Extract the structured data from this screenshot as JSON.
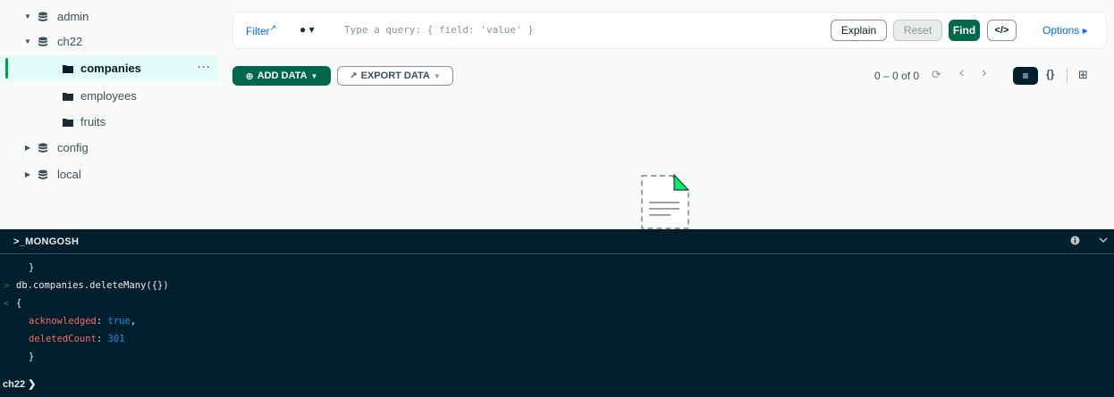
{
  "sidebar": {
    "databases": [
      {
        "name": "admin",
        "expanded": true
      },
      {
        "name": "ch22",
        "expanded": true,
        "collections": [
          "companies",
          "employees",
          "fruits"
        ]
      },
      {
        "name": "config",
        "expanded": false
      },
      {
        "name": "local",
        "expanded": false
      }
    ],
    "active_collection": "companies",
    "more_label": "···",
    "icons": {
      "database": "database-icon",
      "collection": "folder-icon"
    }
  },
  "query_bar": {
    "filter_label": "Filter",
    "filter_ext_icon": "↗",
    "history_icon": "● ▾",
    "placeholder": "Type a query: { field: 'value' }",
    "explain_label": "Explain",
    "reset_label": "Reset",
    "find_label": "Find",
    "code_label": "</>",
    "options_label": "Options ▸"
  },
  "toolbar": {
    "add_data_label": "ADD DATA",
    "export_data_label": "EXPORT DATA",
    "pagination": "0 – 0 of 0",
    "refresh_icon": "⟳",
    "prev_icon": "‹",
    "next_icon": "›",
    "view_list_icon": "≡",
    "view_json_icon": "{}",
    "view_table_icon": "⊞"
  },
  "shell": {
    "title": ">_MONGOSH",
    "info_icon": "🛈",
    "collapse_icon": "⌄",
    "lines": [
      {
        "prefix": "",
        "text": "}"
      },
      {
        "prefix": ">",
        "text": "db.companies.deleteMany({})"
      },
      {
        "prefix": "<",
        "text": "{"
      },
      {
        "prefix": "",
        "key": "acknowledged",
        "value": "true",
        "suffix": ","
      },
      {
        "prefix": "",
        "key": "deletedCount",
        "value": "301",
        "suffix": ""
      },
      {
        "prefix": "",
        "text": "}"
      }
    ],
    "prompt": "ch22 ❯"
  },
  "colors": {
    "accent_green": "#00684a",
    "link_blue": "#016bf8",
    "shell_bg": "#001e2b",
    "shell_key": "#ff6960",
    "shell_value": "#0498ec"
  }
}
